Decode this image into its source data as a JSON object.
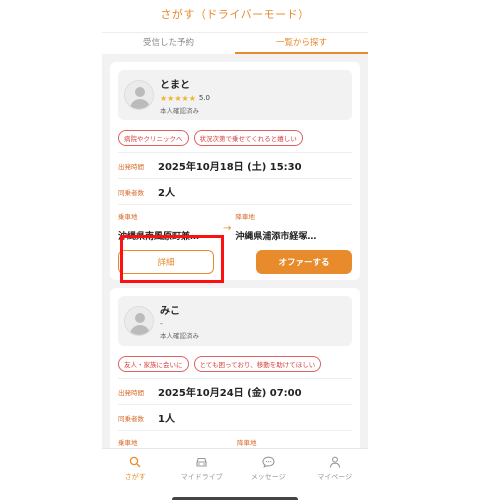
{
  "header": {
    "title": "さがす（ドライバーモード）"
  },
  "tabs": [
    {
      "label": "受信した予約",
      "active": false
    },
    {
      "label": "一覧から探す",
      "active": true
    }
  ],
  "cards": [
    {
      "name": "とまと",
      "stars": "★★★★★",
      "rating": "5.0",
      "verified": "本人確認済み",
      "tags": [
        "病院やクリニックへ",
        "状況次第で乗せてくれると嬉しい"
      ],
      "departure_label": "出発時間",
      "departure": "2025年10月18日 (土) 15:30",
      "passengers_label": "同乗者数",
      "passengers": "2人",
      "pickup_label": "乗車地",
      "pickup": "沖縄県南風原町兼…",
      "dropoff_label": "降車地",
      "dropoff": "沖縄県浦添市経塚…",
      "detail_label": "詳細",
      "offer_label": "オファーする"
    },
    {
      "name": "みこ",
      "dash": "-",
      "verified": "本人確認済み",
      "tags": [
        "友人・家族に会いに",
        "とても困っており、移動を助けてほしい"
      ],
      "departure_label": "出発時間",
      "departure": "2025年10月24日 (金) 07:00",
      "passengers_label": "同乗者数",
      "passengers": "1人",
      "pickup_label": "乗車地",
      "dropoff_label": "降車地"
    }
  ],
  "nav": [
    {
      "label": "さがす",
      "icon": "search-icon",
      "active": true
    },
    {
      "label": "マイドライブ",
      "icon": "car-icon",
      "active": false
    },
    {
      "label": "メッセージ",
      "icon": "chat-icon",
      "active": false
    },
    {
      "label": "マイページ",
      "icon": "person-icon",
      "active": false
    }
  ],
  "colors": {
    "accent": "#e88b2c",
    "tag": "#d84040",
    "highlight": "#ff1010"
  }
}
